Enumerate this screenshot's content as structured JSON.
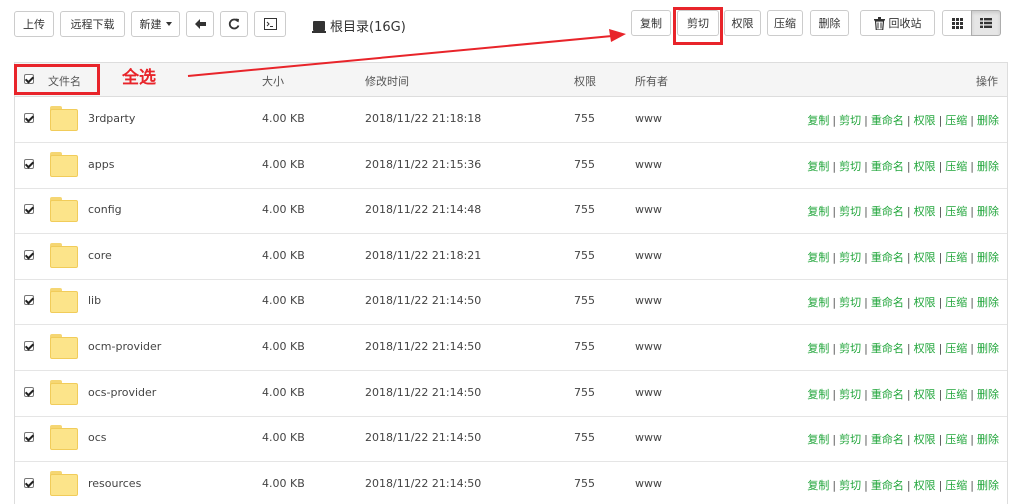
{
  "toolbar": {
    "upload": "上传",
    "remote_download": "远程下载",
    "new": "新建",
    "path": "根目录(16G)",
    "copy": "复制",
    "cut": "剪切",
    "permission": "权限",
    "compress": "压缩",
    "delete": "删除",
    "recycle_bin": "回收站"
  },
  "annotation": {
    "select_all": "全选"
  },
  "table": {
    "headers": {
      "filename": "文件名",
      "size": "大小",
      "mtime": "修改时间",
      "permission": "权限",
      "owner": "所有者",
      "actions": "操作"
    },
    "rows": [
      {
        "name": "3rdparty",
        "size": "4.00 KB",
        "mtime": "2018/11/22 21:18:18",
        "perm": "755",
        "owner": "www"
      },
      {
        "name": "apps",
        "size": "4.00 KB",
        "mtime": "2018/11/22 21:15:36",
        "perm": "755",
        "owner": "www"
      },
      {
        "name": "config",
        "size": "4.00 KB",
        "mtime": "2018/11/22 21:14:48",
        "perm": "755",
        "owner": "www"
      },
      {
        "name": "core",
        "size": "4.00 KB",
        "mtime": "2018/11/22 21:18:21",
        "perm": "755",
        "owner": "www"
      },
      {
        "name": "lib",
        "size": "4.00 KB",
        "mtime": "2018/11/22 21:14:50",
        "perm": "755",
        "owner": "www"
      },
      {
        "name": "ocm-provider",
        "size": "4.00 KB",
        "mtime": "2018/11/22 21:14:50",
        "perm": "755",
        "owner": "www"
      },
      {
        "name": "ocs-provider",
        "size": "4.00 KB",
        "mtime": "2018/11/22 21:14:50",
        "perm": "755",
        "owner": "www"
      },
      {
        "name": "ocs",
        "size": "4.00 KB",
        "mtime": "2018/11/22 21:14:50",
        "perm": "755",
        "owner": "www"
      },
      {
        "name": "resources",
        "size": "4.00 KB",
        "mtime": "2018/11/22 21:14:50",
        "perm": "755",
        "owner": "www"
      }
    ],
    "row_actions": [
      "复制",
      "剪切",
      "重命名",
      "权限",
      "压缩",
      "删除"
    ]
  },
  "colors": {
    "accent_green": "#20a53a",
    "annotation_red": "#e8242a"
  }
}
